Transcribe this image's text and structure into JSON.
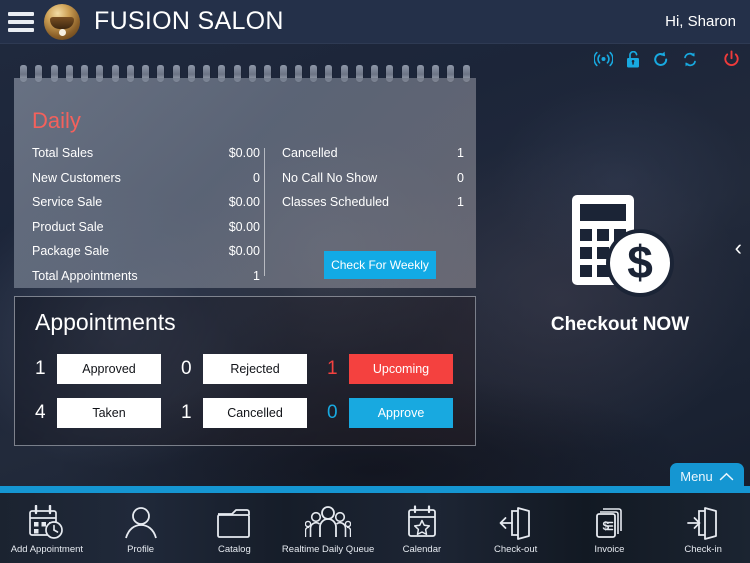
{
  "header": {
    "menu_icon": "hamburger-icon",
    "logo_icon": "salon-logo",
    "title": "FUSION SALON",
    "greeting": "Hi, Sharon"
  },
  "status_icons": [
    {
      "name": "broadcast-icon",
      "color": "#18a9e0"
    },
    {
      "name": "unlocked-lock-icon",
      "color": "#18a9e0"
    },
    {
      "name": "refresh-icon",
      "color": "#18a9e0"
    },
    {
      "name": "sync-icon",
      "color": "#18a9e0"
    },
    {
      "name": "power-icon",
      "color": "#ef3b3b"
    }
  ],
  "daily_card": {
    "title": "Daily",
    "title_color": "#f4615c",
    "left_stats": [
      {
        "label": "Total Sales",
        "value": "$0.00"
      },
      {
        "label": "New Customers",
        "value": "0"
      },
      {
        "label": "Service Sale",
        "value": "$0.00"
      },
      {
        "label": "Product Sale",
        "value": "$0.00"
      },
      {
        "label": "Package Sale",
        "value": "$0.00"
      },
      {
        "label": "Total Appointments",
        "value": "1"
      }
    ],
    "right_stats": [
      {
        "label": "Cancelled",
        "value": "1"
      },
      {
        "label": "No Call No Show",
        "value": "0"
      },
      {
        "label": "Classes Scheduled",
        "value": "1"
      }
    ],
    "weekly_button": "Check For Weekly"
  },
  "appointments": {
    "title": "Appointments",
    "cells": [
      {
        "count": "1",
        "label": "Approved",
        "style": "light",
        "count_color": "#ffffff"
      },
      {
        "count": "0",
        "label": "Rejected",
        "style": "light",
        "count_color": "#ffffff"
      },
      {
        "count": "1",
        "label": "Upcoming",
        "style": "red",
        "count_color": "#f4413f"
      },
      {
        "count": "4",
        "label": "Taken",
        "style": "light",
        "count_color": "#ffffff"
      },
      {
        "count": "1",
        "label": "Cancelled",
        "style": "light",
        "count_color": "#ffffff"
      },
      {
        "count": "0",
        "label": "Approve",
        "style": "blue",
        "count_color": "#18a9e0"
      }
    ]
  },
  "checkout": {
    "icon": "calculator-dollar-icon",
    "label": "Checkout NOW"
  },
  "edge_chevron": "‹",
  "menu_tab": {
    "label": "Menu",
    "icon": "chevron-up-icon"
  },
  "bottom_tabs": [
    {
      "label": "Add Appointment",
      "icon": "calendar-clock-icon"
    },
    {
      "label": "Profile",
      "icon": "person-icon"
    },
    {
      "label": "Catalog",
      "icon": "folder-icon"
    },
    {
      "label": "Realtime Daily Queue",
      "icon": "people-group-icon"
    },
    {
      "label": "Calendar",
      "icon": "calendar-star-icon"
    },
    {
      "label": "Check-out",
      "icon": "exit-left-door-icon"
    },
    {
      "label": "Invoice",
      "icon": "invoice-icon"
    },
    {
      "label": "Check-in",
      "icon": "enter-right-door-icon"
    }
  ],
  "colors": {
    "accent_blue": "#18a9e0",
    "accent_red": "#f4413f",
    "header_bg": "#243049",
    "stripe": "#1596d2"
  }
}
